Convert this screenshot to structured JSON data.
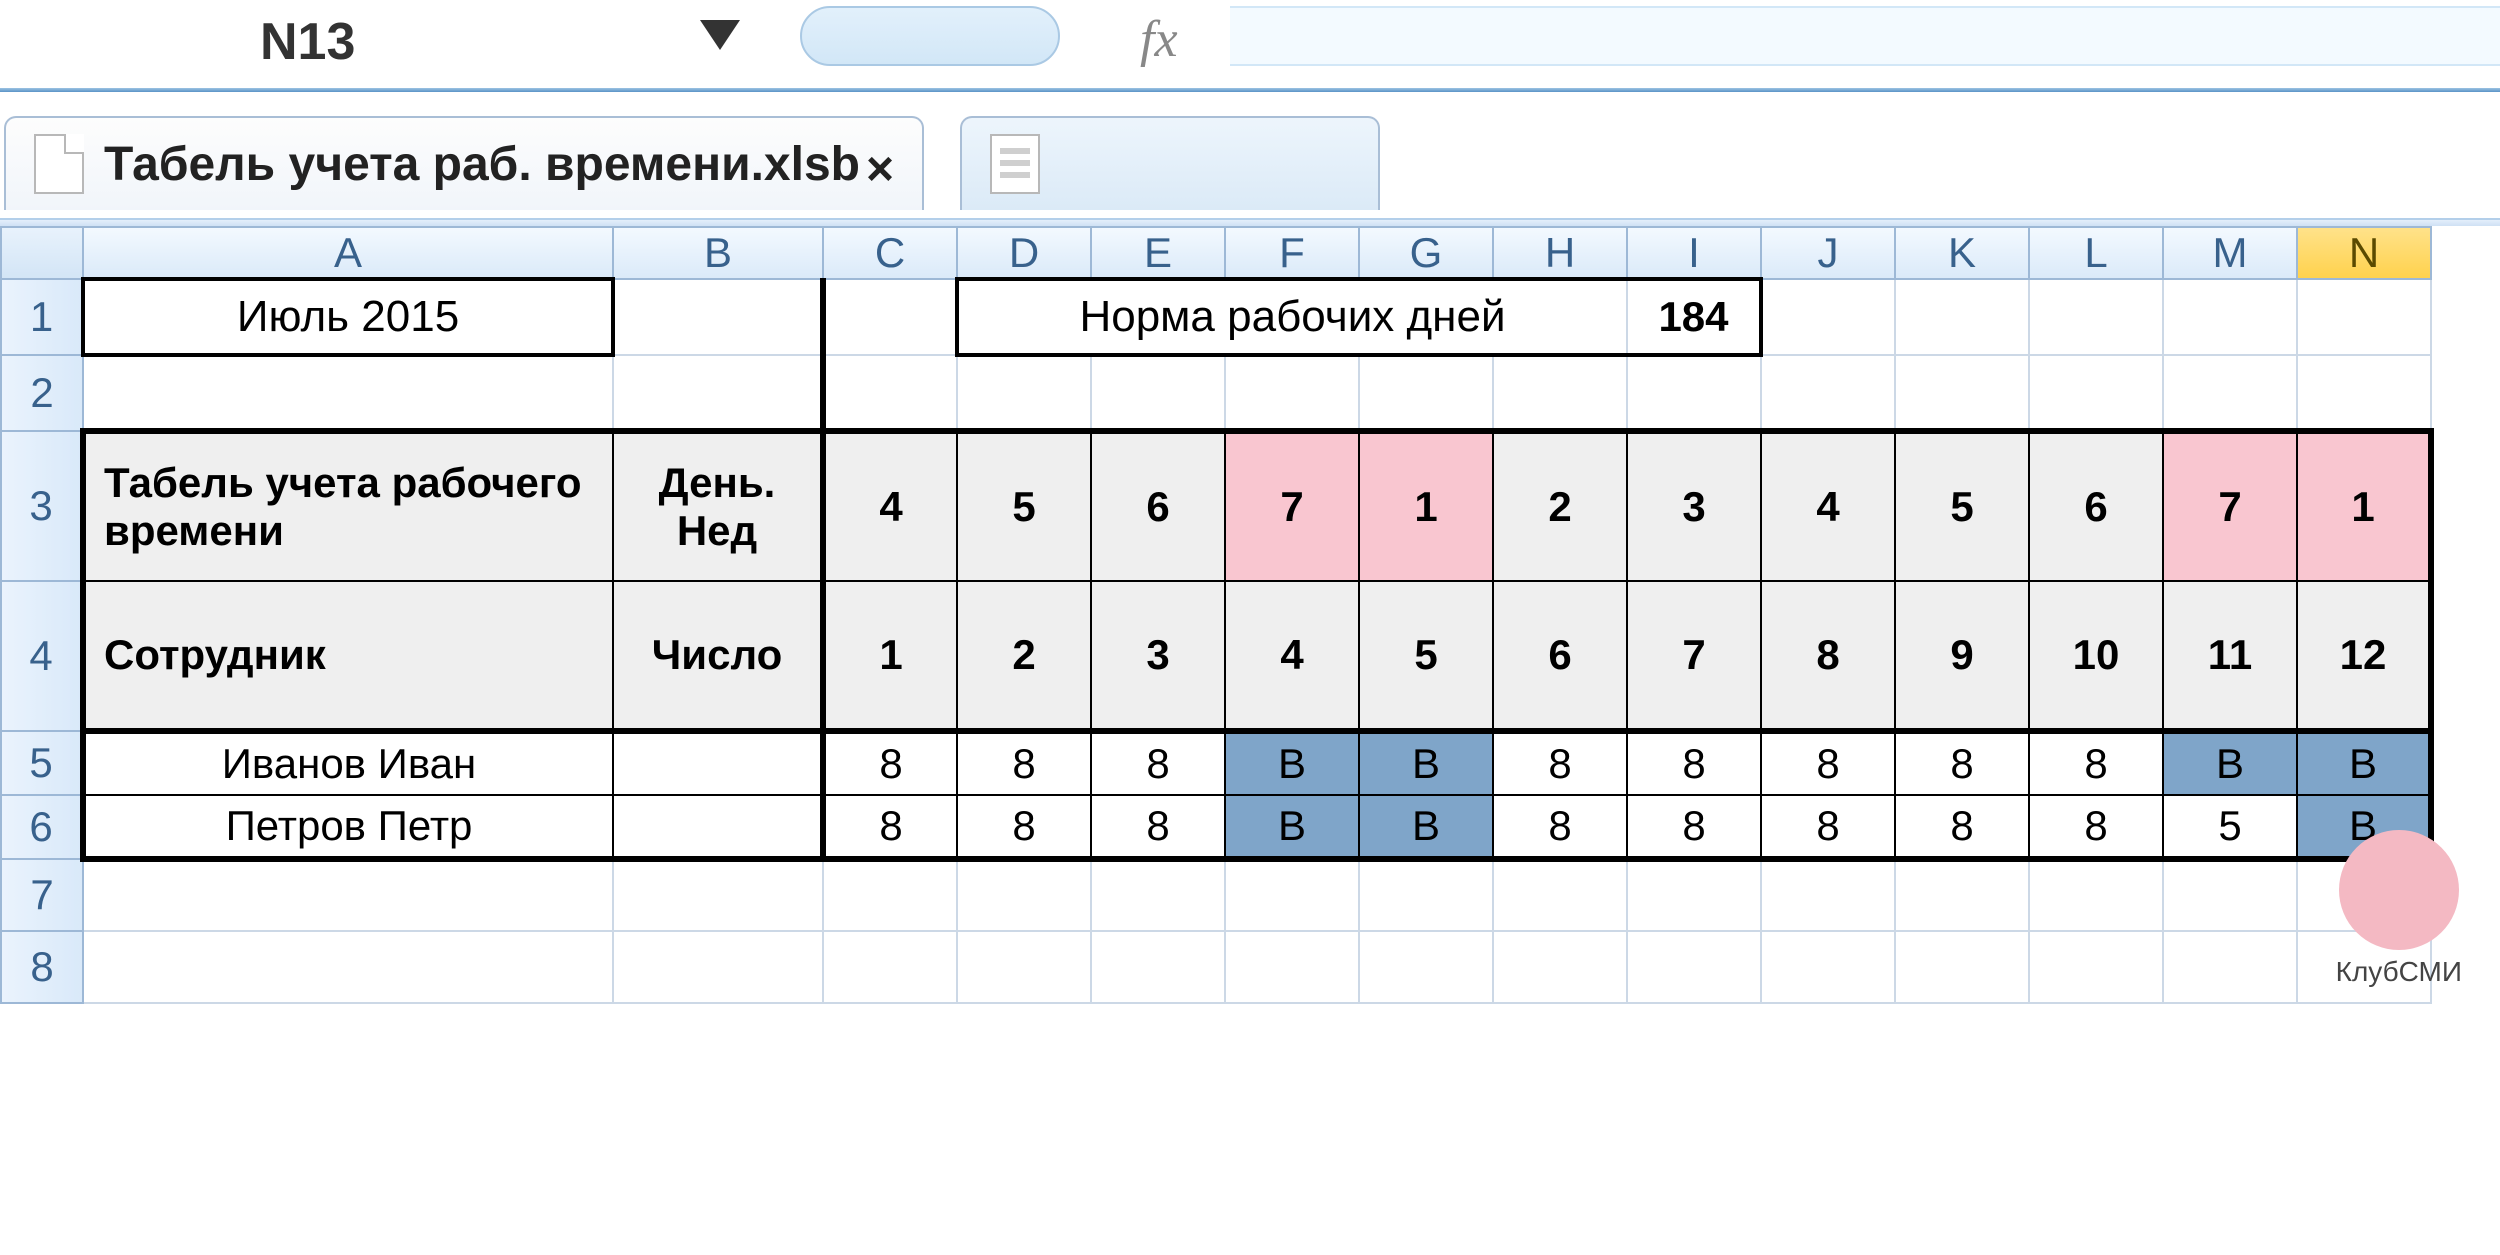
{
  "namebox": {
    "value": "N13"
  },
  "fx": {
    "symbol": "fx"
  },
  "tab": {
    "label": "Табель учета раб. времени.xlsb",
    "close": "×"
  },
  "columns": [
    "A",
    "B",
    "C",
    "D",
    "E",
    "F",
    "G",
    "H",
    "I",
    "J",
    "K",
    "L",
    "M",
    "N"
  ],
  "row_headers": [
    "1",
    "2",
    "3",
    "4",
    "5",
    "6",
    "7",
    "8"
  ],
  "row1": {
    "month": "Июль 2015",
    "norm_label": "Норма рабочих дней",
    "norm_value": "184"
  },
  "row3": {
    "title": "Табель учета рабочего времени",
    "dayofweek_hdr": "День. Нед",
    "dow": [
      "4",
      "5",
      "6",
      "7",
      "1",
      "2",
      "3",
      "4",
      "5",
      "6",
      "7",
      "1"
    ]
  },
  "row4": {
    "employee_hdr": "Сотрудник",
    "date_hdr": "Число",
    "dates": [
      "1",
      "2",
      "3",
      "4",
      "5",
      "6",
      "7",
      "8",
      "9",
      "10",
      "11",
      "12"
    ]
  },
  "employees": [
    {
      "name": "Иванов Иван",
      "hours": [
        "8",
        "8",
        "8",
        "В",
        "В",
        "8",
        "8",
        "8",
        "8",
        "8",
        "В",
        "В"
      ]
    },
    {
      "name": "Петров Петр",
      "hours": [
        "8",
        "8",
        "8",
        "В",
        "В",
        "8",
        "8",
        "8",
        "8",
        "8",
        "5",
        "В"
      ]
    }
  ],
  "weekend_cols": [
    3,
    4,
    10,
    11
  ],
  "watermark": "КлубСМИ"
}
